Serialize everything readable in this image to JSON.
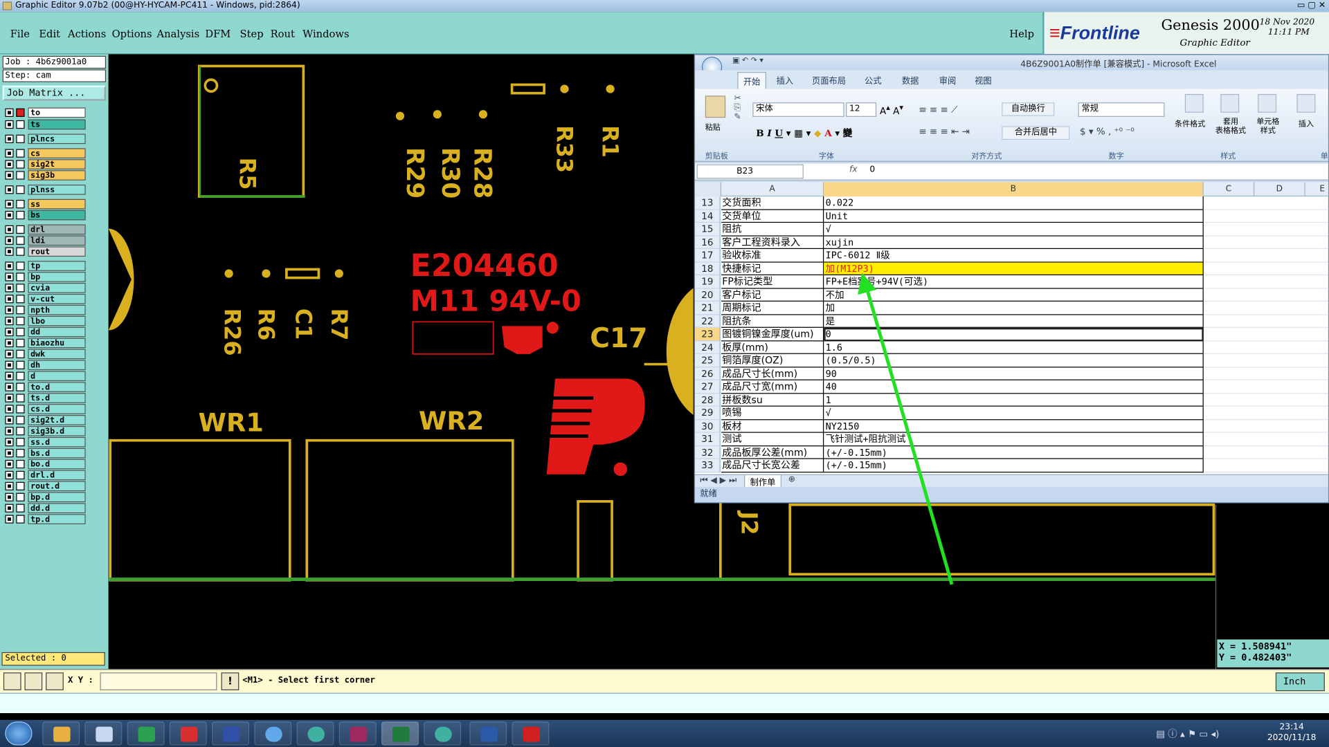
{
  "window": {
    "title": "Graphic Editor 9.07b2 (00@HY-HYCAM-PC411 - Windows, pid:2864)"
  },
  "menu": {
    "items": [
      "File",
      "Edit",
      "Actions",
      "Options",
      "Analysis",
      "DFM",
      "Step",
      "Rout",
      "Windows"
    ],
    "help": "Help"
  },
  "brand": {
    "logo": "Frontline",
    "product": "Genesis 2000",
    "subtitle": "Graphic Editor",
    "date": "18 Nov 2020",
    "time": "11:11 PM"
  },
  "job": {
    "job_line": "Job : 4b6z9001a0",
    "step_line": "Step: cam",
    "matrix_button": "Job Matrix ..."
  },
  "layers": [
    {
      "name": "to",
      "color": "#ffffff"
    },
    {
      "name": "ts",
      "color": "#3fb8a2"
    },
    {
      "name": "plncs",
      "color": "#8fe0d8"
    },
    {
      "name": "cs",
      "color": "#f4c85c"
    },
    {
      "name": "sig2t",
      "color": "#f4c85c"
    },
    {
      "name": "sig3b",
      "color": "#f4c85c"
    },
    {
      "name": "plnss",
      "color": "#8fe0d8"
    },
    {
      "name": "ss",
      "color": "#f4c85c"
    },
    {
      "name": "bs",
      "color": "#3fb8a2"
    },
    {
      "name": "drl",
      "color": "#9fb8b6"
    },
    {
      "name": "ldi",
      "color": "#9fb8b6"
    },
    {
      "name": "rout",
      "color": "#d8d8d8"
    },
    {
      "name": "tp",
      "color": "#8fe0d8"
    },
    {
      "name": "bp",
      "color": "#8fe0d8"
    },
    {
      "name": "cvia",
      "color": "#8fe0d8"
    },
    {
      "name": "v-cut",
      "color": "#8fe0d8"
    },
    {
      "name": "npth",
      "color": "#8fe0d8"
    },
    {
      "name": "lbo",
      "color": "#8fe0d8"
    },
    {
      "name": "dd",
      "color": "#8fe0d8"
    },
    {
      "name": "biaozhu",
      "color": "#8fe0d8"
    },
    {
      "name": "dwk",
      "color": "#8fe0d8"
    },
    {
      "name": "dh",
      "color": "#8fe0d8"
    },
    {
      "name": "d",
      "color": "#8fe0d8"
    },
    {
      "name": "to.d",
      "color": "#8fe0d8"
    },
    {
      "name": "ts.d",
      "color": "#8fe0d8"
    },
    {
      "name": "cs.d",
      "color": "#8fe0d8"
    },
    {
      "name": "sig2t.d",
      "color": "#8fe0d8"
    },
    {
      "name": "sig3b.d",
      "color": "#8fe0d8"
    },
    {
      "name": "ss.d",
      "color": "#8fe0d8"
    },
    {
      "name": "bs.d",
      "color": "#8fe0d8"
    },
    {
      "name": "bo.d",
      "color": "#8fe0d8"
    },
    {
      "name": "drl.d",
      "color": "#8fe0d8"
    },
    {
      "name": "rout.d",
      "color": "#8fe0d8"
    },
    {
      "name": "bp.d",
      "color": "#8fe0d8"
    },
    {
      "name": "dd.d",
      "color": "#8fe0d8"
    },
    {
      "name": "tp.d",
      "color": "#8fe0d8"
    }
  ],
  "selected": "Selected : 0",
  "coords": {
    "x": "X = 1.508941\"",
    "y": "Y = 0.482403\""
  },
  "command": {
    "xy_label": "X Y :",
    "prompt": "<M1> - Select first corner",
    "units": "Inch"
  },
  "pcb": {
    "labels": [
      "R5",
      "R33",
      "R1",
      "R29",
      "R30",
      "R28",
      "R26",
      "R6",
      "C1",
      "R7",
      "C17",
      "WR1",
      "WR2",
      "J2"
    ],
    "marking_line1": "E204460",
    "marking_line2": "M11 94V-0"
  },
  "excel": {
    "title": "4B6Z9001A0制作单 [兼容模式] - Microsoft Excel",
    "tabs": [
      "开始",
      "插入",
      "页面布局",
      "公式",
      "数据",
      "审阅",
      "视图"
    ],
    "ribbon": {
      "paste": "粘贴",
      "font_name": "宋体",
      "font_size": "12",
      "wrap": "自动换行",
      "merge": "合并后居中",
      "number_format": "常规",
      "cond_format": "条件格式",
      "table_format": "套用\n表格格式",
      "cell_style": "单元格\n样式",
      "insert": "插入",
      "groups": [
        "剪贴板",
        "字体",
        "对齐方式",
        "数字",
        "样式",
        "单"
      ]
    },
    "name_box": "B23",
    "formula": "0",
    "columns": [
      "A",
      "B",
      "C",
      "D",
      "E"
    ],
    "rows": [
      {
        "n": "13",
        "a": "交货面积",
        "b": "0.022"
      },
      {
        "n": "14",
        "a": "交货单位",
        "b": "Unit"
      },
      {
        "n": "15",
        "a": "阻抗",
        "b": "√"
      },
      {
        "n": "16",
        "a": "客户工程资料录入",
        "b": "xujin"
      },
      {
        "n": "17",
        "a": "验收标准",
        "b": "IPC-6012 Ⅱ级"
      },
      {
        "n": "18",
        "a": "快捷标记",
        "b": "加(M12P3)",
        "hl": true
      },
      {
        "n": "19",
        "a": "FP标记类型",
        "b": "FP+E档案号+94V(可选)"
      },
      {
        "n": "20",
        "a": "客户标记",
        "b": "不加"
      },
      {
        "n": "21",
        "a": "周期标记",
        "b": "加"
      },
      {
        "n": "22",
        "a": "阻抗条",
        "b": "是"
      },
      {
        "n": "23",
        "a": "图镀铜镍金厚度(um)",
        "b": "0",
        "sel": true
      },
      {
        "n": "24",
        "a": "板厚(mm)",
        "b": "1.6"
      },
      {
        "n": "25",
        "a": "铜箔厚度(OZ)",
        "b": "(0.5/0.5)"
      },
      {
        "n": "26",
        "a": "成品尺寸长(mm)",
        "b": "90"
      },
      {
        "n": "27",
        "a": "成品尺寸宽(mm)",
        "b": "40"
      },
      {
        "n": "28",
        "a": "拼板数su",
        "b": "1"
      },
      {
        "n": "29",
        "a": "喷锡",
        "b": "√"
      },
      {
        "n": "30",
        "a": "板材",
        "b": "NY2150"
      },
      {
        "n": "31",
        "a": "测试",
        "b": "飞针测试+阻抗测试"
      },
      {
        "n": "32",
        "a": "成品板厚公差(mm)",
        "b": "(+/-0.15mm)"
      },
      {
        "n": "33",
        "a": "成品尺寸长宽公差",
        "b": "(+/-0.15mm)"
      }
    ],
    "sheet_tab": "制作单",
    "status": "就绪"
  },
  "taskbar": {
    "time": "23:14",
    "date": "2020/11/18"
  }
}
